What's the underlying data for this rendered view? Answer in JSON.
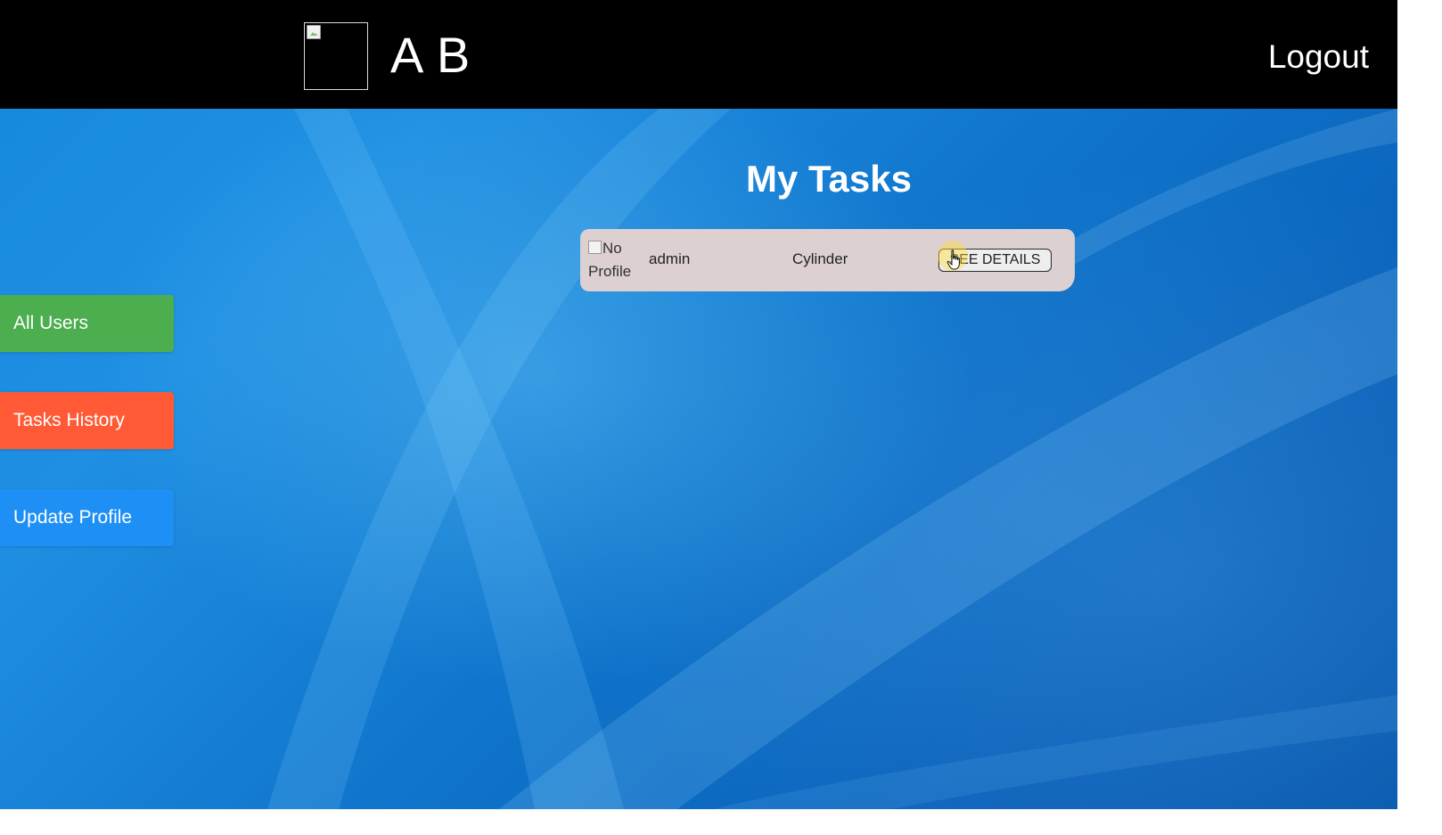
{
  "header": {
    "brand_title": "A B",
    "logout_label": "Logout"
  },
  "main": {
    "title": "My Tasks"
  },
  "sidebar": {
    "items": [
      {
        "label": "All Users",
        "color": "#4cae4f"
      },
      {
        "label": "Tasks History",
        "color": "#ff5a35"
      },
      {
        "label": "Update Profile",
        "color": "#1e90f5"
      }
    ]
  },
  "tasks": [
    {
      "avatar_alt_line1": "No",
      "avatar_alt_line2": "Profile",
      "user": "admin",
      "task": "Cylinder",
      "action_label": "SEE DETAILS"
    }
  ],
  "icons": {
    "logo": "broken-image-icon",
    "cursor": "hand-pointer-icon"
  }
}
